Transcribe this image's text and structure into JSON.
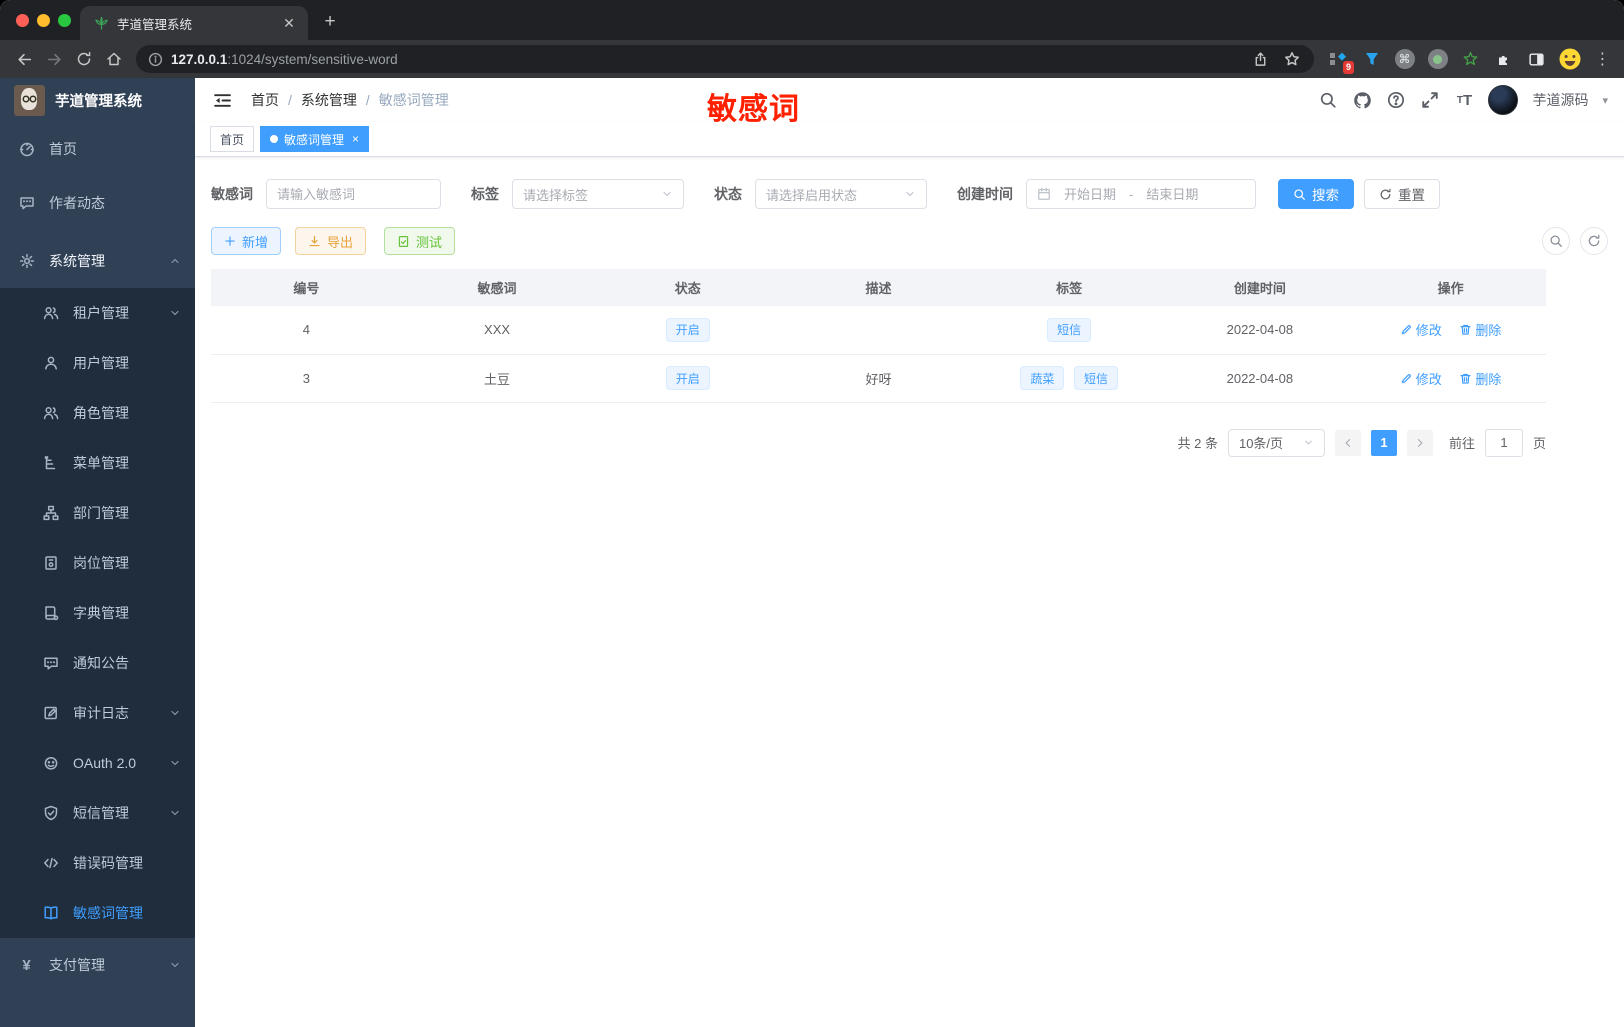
{
  "browser": {
    "tab_title": "芋道管理系统",
    "url_host": "127.0.0.1",
    "url_rest": ":1024/system/sensitive-word",
    "extension_badge": "9"
  },
  "sidebar": {
    "logo_title": "芋道管理系统",
    "items": [
      {
        "label": "首页"
      },
      {
        "label": "作者动态"
      },
      {
        "label": "系统管理"
      },
      {
        "label": "租户管理"
      },
      {
        "label": "用户管理"
      },
      {
        "label": "角色管理"
      },
      {
        "label": "菜单管理"
      },
      {
        "label": "部门管理"
      },
      {
        "label": "岗位管理"
      },
      {
        "label": "字典管理"
      },
      {
        "label": "通知公告"
      },
      {
        "label": "审计日志"
      },
      {
        "label": "OAuth 2.0"
      },
      {
        "label": "短信管理"
      },
      {
        "label": "错误码管理"
      },
      {
        "label": "敏感词管理"
      },
      {
        "label": "支付管理"
      }
    ]
  },
  "header": {
    "breadcrumb": [
      "首页",
      "系统管理",
      "敏感词管理"
    ],
    "separator": "/",
    "annotation": "敏感词",
    "username": "芋道源码"
  },
  "tabs": [
    {
      "label": "首页"
    },
    {
      "label": "敏感词管理"
    }
  ],
  "filters": {
    "keyword_label": "敏感词",
    "keyword_placeholder": "请输入敏感词",
    "tag_label": "标签",
    "tag_placeholder": "请选择标签",
    "status_label": "状态",
    "status_placeholder": "请选择启用状态",
    "date_label": "创建时间",
    "date_start_placeholder": "开始日期",
    "date_separator": "-",
    "date_end_placeholder": "结束日期",
    "search_label": "搜索",
    "reset_label": "重置"
  },
  "toolbar": {
    "add_label": "新增",
    "export_label": "导出",
    "test_label": "测试"
  },
  "table": {
    "columns": [
      "编号",
      "敏感词",
      "状态",
      "描述",
      "标签",
      "创建时间",
      "操作"
    ],
    "rows": [
      {
        "id": "4",
        "word": "XXX",
        "status": "开启",
        "desc": "",
        "tag1": "短信",
        "created": "2022-04-08"
      },
      {
        "id": "3",
        "word": "土豆",
        "status": "开启",
        "desc": "好呀",
        "tag1": "蔬菜",
        "tag2": "短信",
        "created": "2022-04-08"
      }
    ],
    "edit_label": "修改",
    "delete_label": "删除"
  },
  "pagination": {
    "total_text": "共 2 条",
    "page_size": "10条/页",
    "current_page": "1",
    "goto_label": "前往",
    "goto_value": "1",
    "page_unit": "页"
  },
  "colors": {
    "accent": "#409eff",
    "annotation": "#ff2000"
  }
}
